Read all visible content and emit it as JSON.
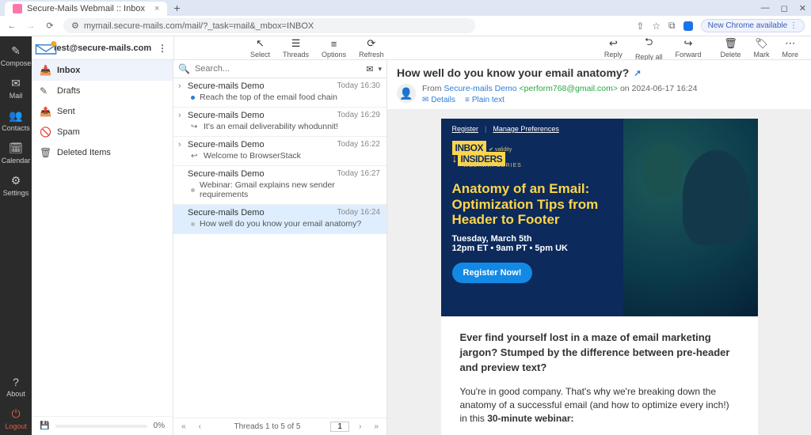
{
  "browser": {
    "tab_title": "Secure-Mails Webmail :: Inbox",
    "url": "mymail.secure-mails.com/mail/?_task=mail&_mbox=INBOX",
    "chrome_pill": "New Chrome available"
  },
  "account": {
    "email": "test@secure-mails.com"
  },
  "sidebar": {
    "items": [
      {
        "label": "Compose"
      },
      {
        "label": "Mail"
      },
      {
        "label": "Contacts"
      },
      {
        "label": "Calendar"
      },
      {
        "label": "Settings"
      }
    ],
    "about": "About",
    "logout": "Logout"
  },
  "toolbar_left": [
    {
      "label": "Select"
    },
    {
      "label": "Threads"
    },
    {
      "label": "Options"
    },
    {
      "label": "Refresh"
    }
  ],
  "toolbar_right": [
    {
      "label": "Reply"
    },
    {
      "label": "Reply all"
    },
    {
      "label": "Forward"
    },
    {
      "label": "Delete"
    },
    {
      "label": "Mark"
    },
    {
      "label": "More"
    }
  ],
  "folders": [
    {
      "label": "Inbox"
    },
    {
      "label": "Drafts"
    },
    {
      "label": "Sent"
    },
    {
      "label": "Spam"
    },
    {
      "label": "Deleted Items"
    }
  ],
  "quota_pct": "0%",
  "search": {
    "placeholder": "Search..."
  },
  "threads": [
    {
      "sender": "Secure-mails Demo",
      "time": "Today 16:30",
      "subject": "Reach the top of the email food chain",
      "icon": "dot",
      "expandable": true
    },
    {
      "sender": "Secure-mails Demo",
      "time": "Today 16:29",
      "subject": "It's an email deliverability whodunnit!",
      "icon": "forward",
      "expandable": true
    },
    {
      "sender": "Secure-mails Demo",
      "time": "Today 16:22",
      "subject": "Welcome to BrowserStack",
      "icon": "reply",
      "expandable": true
    },
    {
      "sender": "Secure-mails Demo",
      "time": "Today 16:27",
      "subject": "Webinar: Gmail explains new sender requirements",
      "icon": "dotgrey",
      "expandable": false
    },
    {
      "sender": "Secure-mails Demo",
      "time": "Today 16:24",
      "subject": "How well do you know your email anatomy?",
      "icon": "dotgrey",
      "expandable": false,
      "selected": true
    }
  ],
  "pager": {
    "summary": "Threads 1 to 5 of 5",
    "page": "1"
  },
  "preview": {
    "subject": "How well do you know your email anatomy?",
    "from_label": "From",
    "from_name": "Secure-mails Demo",
    "from_email": "<perform768@gmail.com>",
    "on_label": "on",
    "date": "2024-06-17 16:24",
    "details": "Details",
    "plain": "Plain text",
    "hero_register": "Register",
    "hero_manage": "Manage Preferences",
    "hero_brand1": "INBOX",
    "hero_brand2": "INSIDERS",
    "hero_series": "WEBINAR SERIES",
    "hero_title": "Anatomy of an Email: Optimization Tips from Header to Footer",
    "hero_date1": "Tuesday, March 5th",
    "hero_date2": "12pm ET • 9am PT • 5pm UK",
    "hero_cta": "Register Now!",
    "body_lede": "Ever find yourself lost in a maze of email marketing jargon? Stumped by the difference between pre-header and preview text?",
    "body_p1a": "You're in good company. That's why we're breaking down the anatomy of a successful email (and how to optimize every inch!) in this ",
    "body_p1b": "30-minute webinar:"
  }
}
